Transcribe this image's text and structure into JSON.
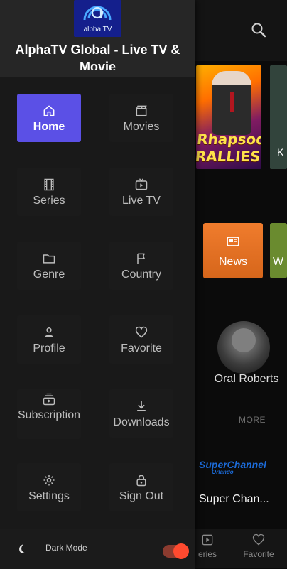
{
  "drawer": {
    "logo_text": "alpha TV",
    "app_title": "AlphaTV Global - Live TV & Movie",
    "menu": [
      {
        "label": "Home",
        "icon": "home-icon"
      },
      {
        "label": "Movies",
        "icon": "clapperboard-icon"
      },
      {
        "label": "Series",
        "icon": "film-strip-icon"
      },
      {
        "label": "Live TV",
        "icon": "tv-icon"
      },
      {
        "label": "Genre",
        "icon": "folder-icon"
      },
      {
        "label": "Country",
        "icon": "flag-icon"
      },
      {
        "label": "Profile",
        "icon": "person-icon"
      },
      {
        "label": "Favorite",
        "icon": "heart-icon"
      },
      {
        "label": "Subscription",
        "icon": "subscription-icon"
      },
      {
        "label": "Downloads",
        "icon": "download-icon"
      },
      {
        "label": "Settings",
        "icon": "gear-icon"
      },
      {
        "label": "Sign Out",
        "icon": "lock-icon"
      }
    ],
    "footer": {
      "dark_mode_label": "Dark Mode",
      "dark_mode_enabled": true
    }
  },
  "background": {
    "poster_text": "Rhapsody\nRALLIES",
    "poster_side_letter": "K",
    "categories": [
      {
        "label": "News"
      },
      {
        "label": "W"
      }
    ],
    "person_name": "Oral Roberts",
    "more_label": "MORE",
    "channel_logo": "SuperChannel",
    "channel_logo_sub": "Orlando",
    "channel_name": "Super Chan...",
    "bottom_nav": [
      {
        "label": "eries",
        "icon": "series-icon"
      },
      {
        "label": "Favorite",
        "icon": "heart-icon"
      }
    ]
  },
  "colors": {
    "accent": "#5b50e6",
    "toggle": "#ff4a2f"
  }
}
